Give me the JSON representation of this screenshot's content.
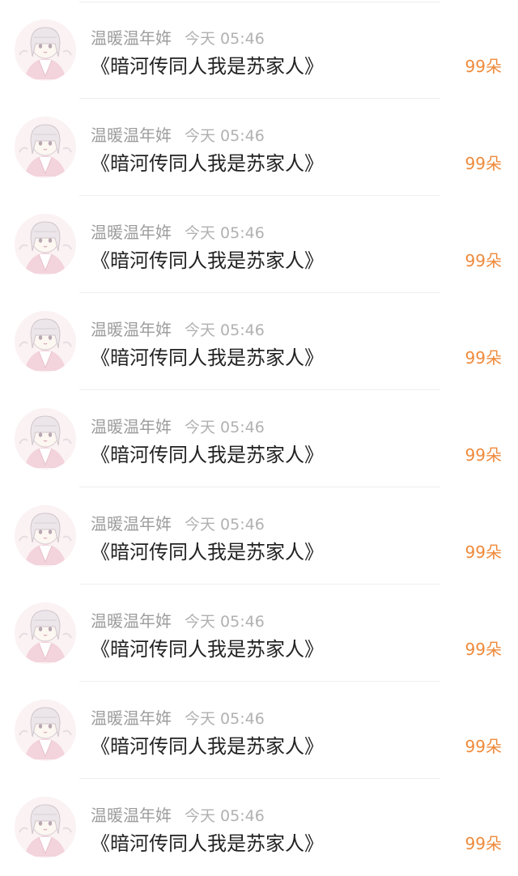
{
  "colors": {
    "background": "#ffffff",
    "name_text": "#9d9d9d",
    "time_text": "#b1b1b1",
    "title_text": "#222222",
    "count_accent": "#ef8a3c",
    "divider": "#efefef"
  },
  "items": [
    {
      "avatar_icon": "anime-girl-avatar-icon",
      "user": "温暖温年姩",
      "time": "今天 05:46",
      "title": "《暗河传同人我是苏家人》",
      "count": "99朵"
    },
    {
      "avatar_icon": "anime-girl-avatar-icon",
      "user": "温暖温年姩",
      "time": "今天 05:46",
      "title": "《暗河传同人我是苏家人》",
      "count": "99朵"
    },
    {
      "avatar_icon": "anime-girl-avatar-icon",
      "user": "温暖温年姩",
      "time": "今天 05:46",
      "title": "《暗河传同人我是苏家人》",
      "count": "99朵"
    },
    {
      "avatar_icon": "anime-girl-avatar-icon",
      "user": "温暖温年姩",
      "time": "今天 05:46",
      "title": "《暗河传同人我是苏家人》",
      "count": "99朵"
    },
    {
      "avatar_icon": "anime-girl-avatar-icon",
      "user": "温暖温年姩",
      "time": "今天 05:46",
      "title": "《暗河传同人我是苏家人》",
      "count": "99朵"
    },
    {
      "avatar_icon": "anime-girl-avatar-icon",
      "user": "温暖温年姩",
      "time": "今天 05:46",
      "title": "《暗河传同人我是苏家人》",
      "count": "99朵"
    },
    {
      "avatar_icon": "anime-girl-avatar-icon",
      "user": "温暖温年姩",
      "time": "今天 05:46",
      "title": "《暗河传同人我是苏家人》",
      "count": "99朵"
    },
    {
      "avatar_icon": "anime-girl-avatar-icon",
      "user": "温暖温年姩",
      "time": "今天 05:46",
      "title": "《暗河传同人我是苏家人》",
      "count": "99朵"
    },
    {
      "avatar_icon": "anime-girl-avatar-icon",
      "user": "温暖温年姩",
      "time": "今天 05:46",
      "title": "《暗河传同人我是苏家人》",
      "count": "99朵"
    }
  ]
}
